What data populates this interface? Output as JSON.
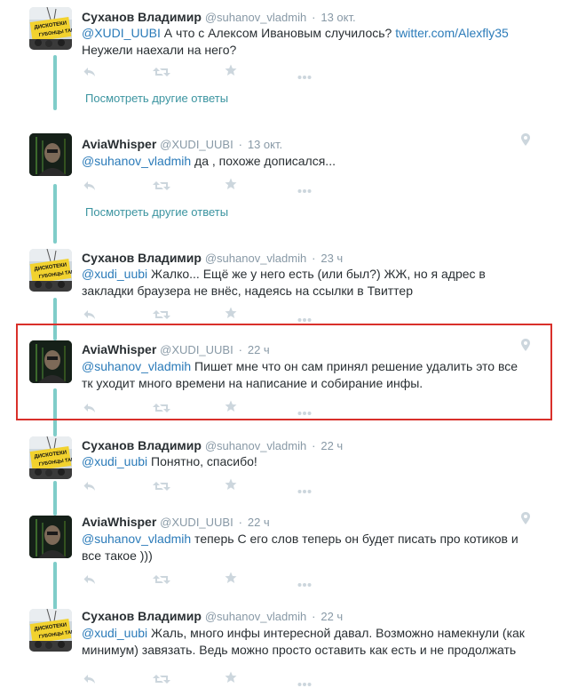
{
  "tweets": [
    {
      "name": "Суханов Владимир",
      "handle": "@suhanov_vladmih",
      "time": "13 окт.",
      "mention": "@XUDI_UUBI",
      "body": " А что с Алексом Ивановым случилось? ",
      "link": "twitter.com/Alexfly35",
      "body2": "Неужели наехали на него?",
      "more_replies": "Посмотреть другие ответы",
      "avatar": "banner-avatar"
    },
    {
      "name": "AviaWhisper",
      "handle": "@XUDI_UUBI",
      "time": "13 окт.",
      "mention": "@suhanov_vladmih",
      "body": " да , похоже дописался...",
      "more_replies": "Посмотреть другие ответы",
      "avatar": "person-avatar",
      "has_geo": true
    },
    {
      "name": "Суханов Владимир",
      "handle": "@suhanov_vladmih",
      "time": "23 ч",
      "mention": "@xudi_uubi",
      "body": " Жалко... Ещё же у него есть (или был?) ЖЖ, но я адрес в",
      "body2": "закладки браузера не внёс, надеясь на ссылки в Твиттер",
      "avatar": "banner-avatar"
    },
    {
      "name": "AviaWhisper",
      "handle": "@XUDI_UUBI",
      "time": "22 ч",
      "mention": "@suhanov_vladmih",
      "body": " Пишет мне что он сам принял решение удалить это все",
      "body2": "тк уходит много времени на написание и собирание инфы.",
      "avatar": "person-avatar",
      "has_geo": true,
      "highlighted": true
    },
    {
      "name": "Суханов Владимир",
      "handle": "@suhanov_vladmih",
      "time": "22 ч",
      "mention": "@xudi_uubi",
      "body": " Понятно, спасибо!",
      "avatar": "banner-avatar"
    },
    {
      "name": "AviaWhisper",
      "handle": "@XUDI_UUBI",
      "time": "22 ч",
      "mention": "@suhanov_vladmih",
      "body": " теперь С его слов теперь он будет писать про котиков и",
      "body2": "все такое )))",
      "avatar": "person-avatar",
      "has_geo": true
    },
    {
      "name": "Суханов Владимир",
      "handle": "@suhanov_vladmih",
      "time": "22 ч",
      "mention": "@xudi_uubi",
      "body": " Жаль, много инфы интересной давал. Возможно намекнули (как",
      "body2": "минимум) завязать. Ведь можно просто оставить как есть и не продолжать",
      "avatar": "banner-avatar"
    }
  ],
  "separator": "·",
  "avatar_banner_text": [
    "ДИСКОТЕКИ",
    "ГУБОНЦЫ ТАК"
  ],
  "colors": {
    "thread_line": "#7fcdc9",
    "link": "#2b7bb9",
    "muted": "#8899a6",
    "highlight_border": "#d9302a",
    "action_icon": "#ccd6dd"
  },
  "icons": [
    "reply-icon",
    "retweet-icon",
    "favorite-icon",
    "more-icon",
    "geo-pin-icon"
  ]
}
